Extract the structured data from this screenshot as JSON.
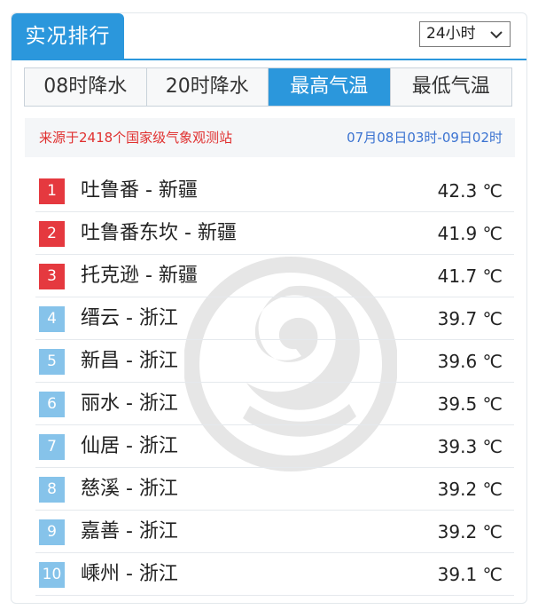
{
  "header": {
    "title": "实况排行",
    "period_select": {
      "value": "24小时"
    }
  },
  "tabs": [
    {
      "label": "08时降水",
      "active": false
    },
    {
      "label": "20时降水",
      "active": false
    },
    {
      "label": "最高气温",
      "active": true
    },
    {
      "label": "最低气温",
      "active": false
    }
  ],
  "info": {
    "source": "来源于2418个国家级气象观测站",
    "time_range": "07月08日03时-09日02时"
  },
  "ranking": [
    {
      "rank": "1",
      "name": "吐鲁番 - 新疆",
      "value": "42.3 ℃"
    },
    {
      "rank": "2",
      "name": "吐鲁番东坎 - 新疆",
      "value": "41.9 ℃"
    },
    {
      "rank": "3",
      "name": "托克逊 - 新疆",
      "value": "41.7 ℃"
    },
    {
      "rank": "4",
      "name": "缙云 - 浙江",
      "value": "39.7 ℃"
    },
    {
      "rank": "5",
      "name": "新昌 - 浙江",
      "value": "39.6 ℃"
    },
    {
      "rank": "6",
      "name": "丽水 - 浙江",
      "value": "39.5 ℃"
    },
    {
      "rank": "7",
      "name": "仙居 - 浙江",
      "value": "39.3 ℃"
    },
    {
      "rank": "8",
      "name": "慈溪 - 浙江",
      "value": "39.2 ℃"
    },
    {
      "rank": "9",
      "name": "嘉善 - 浙江",
      "value": "39.2 ℃"
    },
    {
      "rank": "10",
      "name": "嵊州 - 浙江",
      "value": "39.1 ℃"
    }
  ],
  "colors": {
    "accent": "#2b97dc",
    "top_rank_badge": "#e5393f",
    "rank_badge": "#86c3ea",
    "source_text": "#e0302f",
    "time_text": "#3b73d1"
  },
  "icons": {
    "period_select": "chevron-down-icon",
    "watermark": "weather-logo-watermark"
  }
}
